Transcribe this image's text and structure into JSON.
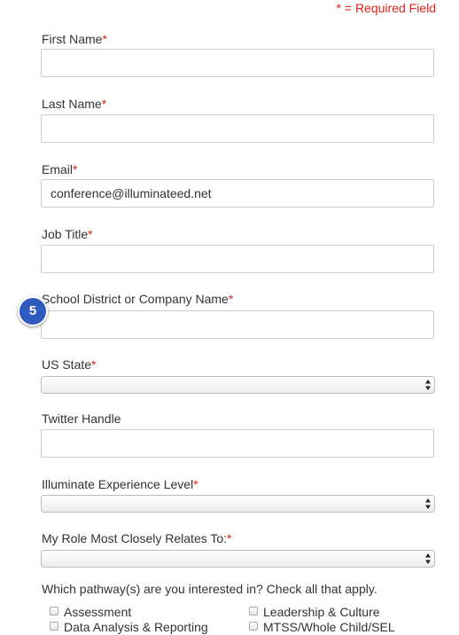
{
  "required_note": "* = Required Field",
  "required_marker": "*",
  "fields": [
    {
      "label": "First Name",
      "value": ""
    },
    {
      "label": "Last Name",
      "value": ""
    },
    {
      "label": "Email",
      "value": "conference@illuminateed.net"
    },
    {
      "label": "Job Title",
      "value": ""
    },
    {
      "label": "School District or Company Name",
      "value": ""
    },
    {
      "label": "US State",
      "selected": ""
    },
    {
      "label": "Twitter Handle",
      "value": ""
    },
    {
      "label": "Illuminate Experience Level",
      "selected": ""
    },
    {
      "label": "My Role Most Closely Relates To:",
      "selected": ""
    }
  ],
  "step_badge": "5",
  "pathway_question": "Which pathway(s) are you interested in? Check all that apply.",
  "pathways": [
    "Assessment",
    "Leadership & Culture",
    "Data Analysis & Reporting",
    "MTSS/Whole Child/SEL"
  ],
  "colors": {
    "required": "#e2231a",
    "badge": "#2e5bbd",
    "text": "#333333",
    "border": "#cfcfcf"
  },
  "icons": {
    "select_arrows": "up-down-arrows-icon",
    "checkbox": "checkbox-icon"
  }
}
